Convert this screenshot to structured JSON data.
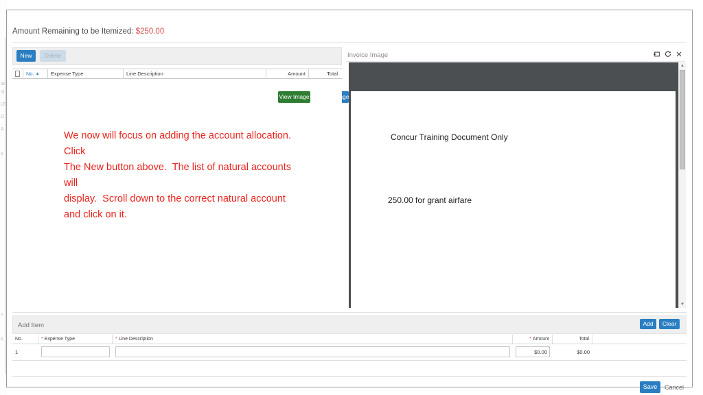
{
  "background": {
    "ghost_fragments": [
      "se",
      "Q",
      "",
      "sf",
      "LF",
      "D",
      "A",
      "",
      "s",
      "e",
      "",
      "",
      "s",
      "n",
      "s"
    ]
  },
  "modal": {
    "itemize_header": {
      "label": "Amount Remaining to be Itemized:",
      "amount": "$250.00",
      "amount_color": "#d9534f"
    },
    "expense_list": {
      "toolbar": {
        "new_label": "New",
        "delete_label": "Delete",
        "view_image_label": "View Image",
        "upload_image_label": "Upload Image",
        "view_image_highlight_color": "#f2f000",
        "view_image_button_color": "#2f7d32",
        "blue_button_color": "#2a7ec1"
      },
      "columns": {
        "no": "No.",
        "sort_caret": "▲",
        "expense_type": "Expense Type",
        "line_description": "Line Description",
        "amount": "Amount",
        "total": "Total"
      },
      "rows": []
    },
    "annotation": {
      "color": "#e8251f",
      "lines": [
        "We now will focus on adding the account allocation.  Click",
        "The New button above.  The list of natural accounts will",
        "display.  Scroll down to the correct natural account and click on it."
      ]
    },
    "invoice_image_panel": {
      "title": "Invoice Image",
      "icons": [
        "maximize-icon",
        "refresh-icon",
        "close-icon"
      ],
      "document": {
        "title_line": "Concur Training Document Only",
        "body_line": "250.00 for grant airfare"
      },
      "scrollbar": {
        "up_arrow": "▲",
        "down_arrow": "▼"
      }
    },
    "add_item": {
      "title": "Add Item",
      "add_label": "Add",
      "clear_label": "Clear",
      "columns": {
        "no": "No.",
        "expense_type": "Expense Type",
        "line_description": "Line Description",
        "amount": "Amount",
        "total": "Total"
      },
      "required_marker": "*",
      "row": {
        "no": "1",
        "expense_type_value": "",
        "line_description_value": "",
        "amount_value": "$0.00",
        "total_value": "$0.00"
      }
    },
    "footer": {
      "save_label": "Save",
      "cancel_label": "Cancel"
    }
  }
}
